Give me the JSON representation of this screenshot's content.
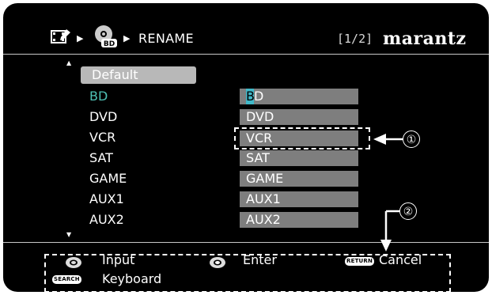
{
  "header": {
    "breadcrumb_label": "RENAME",
    "page_indicator": "[1/2]",
    "brand": "marantz",
    "icons": [
      "video-setup-icon",
      "bd-source-icon"
    ]
  },
  "list": {
    "default_label": "Default",
    "rows": [
      {
        "source": "BD",
        "value": "BD",
        "active": true
      },
      {
        "source": "DVD",
        "value": "DVD"
      },
      {
        "source": "VCR",
        "value": "VCR"
      },
      {
        "source": "SAT",
        "value": "SAT"
      },
      {
        "source": "GAME",
        "value": "GAME"
      },
      {
        "source": "AUX1",
        "value": "AUX1"
      },
      {
        "source": "AUX2",
        "value": "AUX2"
      }
    ],
    "cursor_char": "B",
    "cursor_rest": "D"
  },
  "guide": {
    "input_label": "Input",
    "enter_label": "Enter",
    "cancel_label": "Cancel",
    "keyboard_label": "Keyboard",
    "return_tag": "RETURN",
    "search_tag": "SEARCH"
  },
  "callouts": {
    "one": "①",
    "two": "②"
  },
  "colors": {
    "background": "#000000",
    "active_text": "#4fc0b5",
    "field_bg": "#7e7e7e",
    "cursor": "#40b8c8",
    "default_btn": "#b8b8b8"
  }
}
